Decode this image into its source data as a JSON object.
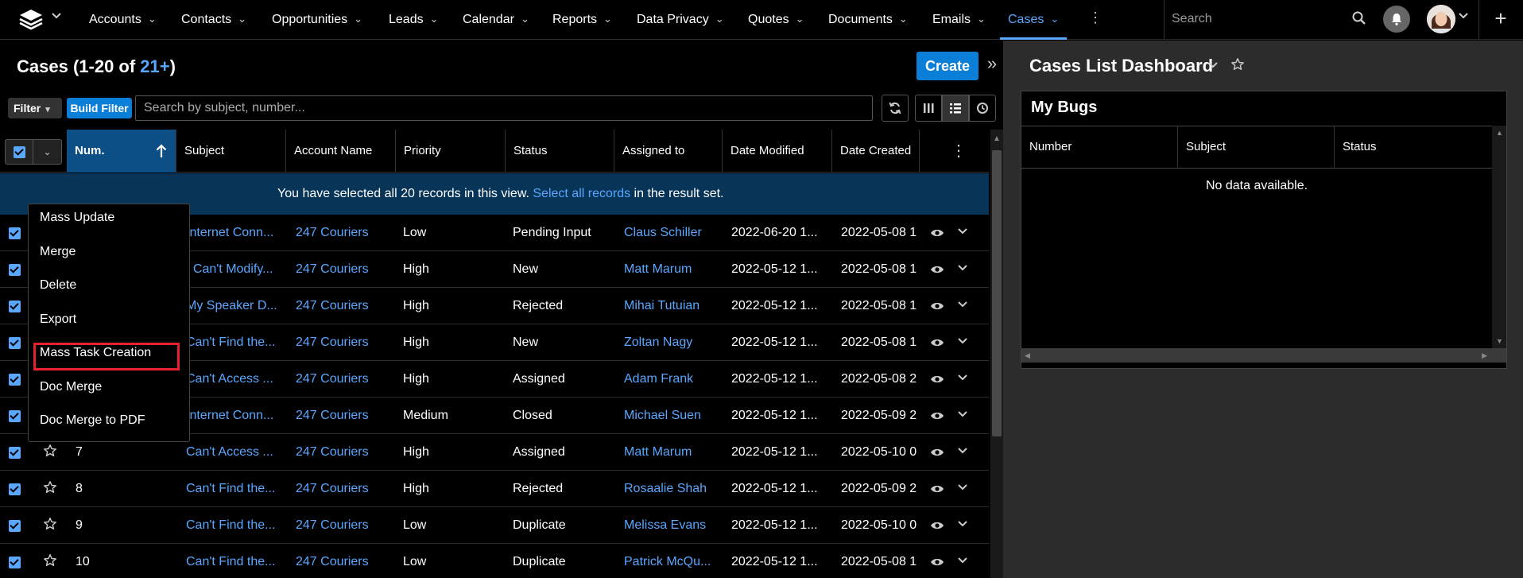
{
  "nav": {
    "items": [
      "Accounts",
      "Contacts",
      "Opportunities",
      "Leads",
      "Calendar",
      "Reports",
      "Data Privacy",
      "Quotes",
      "Documents",
      "Emails",
      "Cases"
    ],
    "active": "Cases",
    "search_placeholder": "Search",
    "more_label": "⋮",
    "plus_label": "+"
  },
  "list": {
    "title_prefix": "Cases (1-20 of ",
    "title_count": "21+",
    "title_suffix": ")",
    "create_label": "Create",
    "collapse_label": "»",
    "filter_label": "Filter",
    "build_filter_label": "Build Filter",
    "search_placeholder": "Search by subject, number...",
    "columns": [
      "Num.",
      "Subject",
      "Account Name",
      "Priority",
      "Status",
      "Assigned to",
      "Date Modified",
      "Date Created"
    ],
    "banner": {
      "prefix": "You have selected all 20 records in this view. ",
      "link": "Select all records",
      "suffix": " in the result set."
    },
    "rows": [
      {
        "num": "",
        "subject": "Internet Conn...",
        "account": "247 Couriers",
        "priority": "Low",
        "status": "Pending Input",
        "assigned": "Claus Schiller",
        "modified": "2022-06-20 1...",
        "created": "2022-05-08 1"
      },
      {
        "num": "",
        "subject": "I Can't Modify...",
        "account": "247 Couriers",
        "priority": "High",
        "status": "New",
        "assigned": "Matt Marum",
        "modified": "2022-05-12 1...",
        "created": "2022-05-08 1"
      },
      {
        "num": "",
        "subject": "My Speaker D...",
        "account": "247 Couriers",
        "priority": "High",
        "status": "Rejected",
        "assigned": "Mihai Tutuian",
        "modified": "2022-05-12 1...",
        "created": "2022-05-08 1"
      },
      {
        "num": "",
        "subject": "Can't Find the...",
        "account": "247 Couriers",
        "priority": "High",
        "status": "New",
        "assigned": "Zoltan Nagy",
        "modified": "2022-05-12 1...",
        "created": "2022-05-08 1"
      },
      {
        "num": "",
        "subject": "Can't Access ...",
        "account": "247 Couriers",
        "priority": "High",
        "status": "Assigned",
        "assigned": "Adam Frank",
        "modified": "2022-05-12 1...",
        "created": "2022-05-08 2"
      },
      {
        "num": "6",
        "subject": "Internet Conn...",
        "account": "247 Couriers",
        "priority": "Medium",
        "status": "Closed",
        "assigned": "Michael Suen",
        "modified": "2022-05-12 1...",
        "created": "2022-05-09 2"
      },
      {
        "num": "7",
        "subject": "Can't Access ...",
        "account": "247 Couriers",
        "priority": "High",
        "status": "Assigned",
        "assigned": "Matt Marum",
        "modified": "2022-05-12 1...",
        "created": "2022-05-10 0"
      },
      {
        "num": "8",
        "subject": "Can't Find the...",
        "account": "247 Couriers",
        "priority": "High",
        "status": "Rejected",
        "assigned": "Rosaalie Shah",
        "modified": "2022-05-12 1...",
        "created": "2022-05-09 2"
      },
      {
        "num": "9",
        "subject": "Can't Find the...",
        "account": "247 Couriers",
        "priority": "Low",
        "status": "Duplicate",
        "assigned": "Melissa Evans",
        "modified": "2022-05-12 1...",
        "created": "2022-05-10 0"
      },
      {
        "num": "10",
        "subject": "Can't Find the...",
        "account": "247 Couriers",
        "priority": "Low",
        "status": "Duplicate",
        "assigned": "Patrick McQu...",
        "modified": "2022-05-12 1...",
        "created": "2022-05-08 1"
      }
    ]
  },
  "mass_actions": {
    "items": [
      "Mass Update",
      "Merge",
      "Delete",
      "Export",
      "Mass Task Creation",
      "Doc Merge",
      "Doc Merge to PDF"
    ],
    "highlighted": "Mass Task Creation",
    "highlight_color": "#e8212b"
  },
  "dashboard": {
    "title": "Cases List Dashboard",
    "dashlet_title": "My Bugs",
    "columns": [
      "Number",
      "Subject",
      "Status"
    ],
    "empty_text": "No data available."
  },
  "colors": {
    "accent": "#5aa7ff",
    "primary_button": "#0b7fd8",
    "selection_banner": "#073457",
    "sorted_column": "#0b4f86"
  }
}
